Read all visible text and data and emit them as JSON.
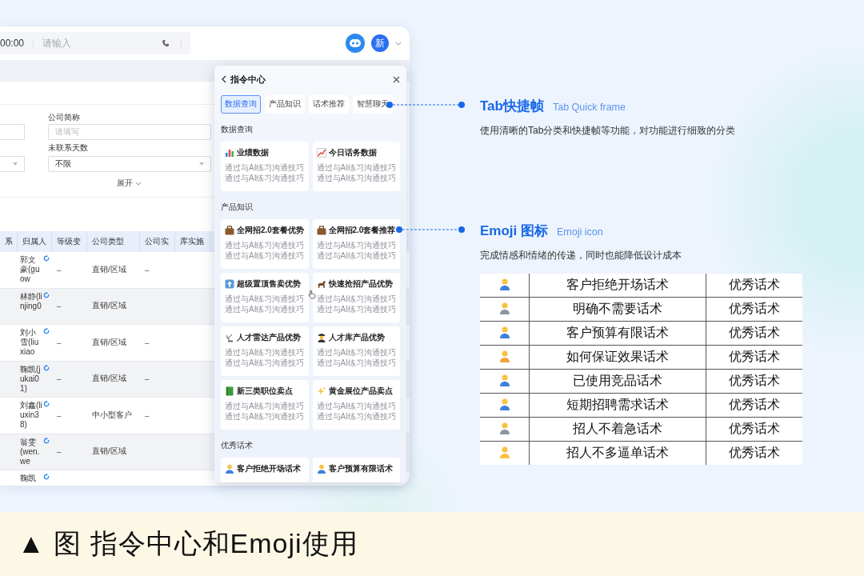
{
  "screen": {
    "top_bar": {
      "time": "00:00",
      "search_placeholder": "请输入",
      "new_badge": "新"
    },
    "form": {
      "fields": [
        {
          "label": "公司简称",
          "placeholder": "请填写"
        },
        {
          "label": "未联系天数",
          "value": "不限"
        }
      ],
      "expand": "展开"
    },
    "table": {
      "columns": [
        "系",
        "归属人",
        "等级变",
        "公司类型",
        "公司实",
        "库实施"
      ],
      "rows": [
        {
          "owner": "郭文豪(guow",
          "level": "–",
          "type": "直销/区域",
          "column_5": "–"
        },
        {
          "owner": "林静(linjing0",
          "level": "–",
          "type": "直销/区域"
        },
        {
          "owner": "刘小雪(liuxiao",
          "level": "–",
          "type": "直销/区域",
          "column_5": "–"
        },
        {
          "owner": "鞠凯(jukai01)",
          "level": "–",
          "type": "直销/区域",
          "column_5": "–"
        },
        {
          "owner": "刘鑫(liuxin38)",
          "level": "–",
          "type": "中小型客户",
          "column_5": "–"
        },
        {
          "owner": "翁雯(wen.we",
          "level": "–",
          "type": "直销/区域"
        },
        {
          "owner": "鞠凯"
        }
      ]
    }
  },
  "popup": {
    "title": "指令中心",
    "tabs": [
      {
        "label": "数据查询",
        "selected": true
      },
      {
        "label": "产品知识",
        "selected": false
      },
      {
        "label": "话术推荐",
        "selected": false
      },
      {
        "label": "智慧聊天",
        "selected": false
      }
    ],
    "sections": [
      {
        "title": "数据查询",
        "cards": [
          {
            "title": "业绩数据",
            "desc": "通过与AI练习沟通技巧通过与AI练习沟通技巧"
          },
          {
            "title": "今日话务数据",
            "desc": "通过与AI练习沟通技巧通过与AI练习沟通技巧"
          }
        ]
      },
      {
        "title": "产品知识",
        "cards": [
          {
            "title": "全网招2.0套餐优势",
            "desc": "通过与AI练习沟通技巧通过与AI练习沟通技巧"
          },
          {
            "title": "全网招2.0套餐推荐",
            "desc": "通过与AI练习沟通技巧通过与AI练习沟通技巧"
          },
          {
            "title": "超级置顶售卖优势",
            "desc": "通过与AI练习沟通技巧通过与AI练习沟通技巧"
          },
          {
            "title": "快速抢招产品优势",
            "desc": "通过与AI练习沟通技巧通过与AI练习沟通技巧"
          },
          {
            "title": "人才雷达产品优势",
            "desc": "通过与AI练习沟通技巧通过与AI练习沟通技巧"
          },
          {
            "title": "人才库产品优势",
            "desc": "通过与AI练习沟通技巧通过与AI练习沟通技巧"
          },
          {
            "title": "新三类职位卖点",
            "desc": "通过与AI练习沟通技巧通过与AI练习沟通技巧"
          },
          {
            "title": "黄金展位产品卖点",
            "desc": "通过与AI练习沟通技巧通过与AI练习沟通技巧"
          }
        ]
      },
      {
        "title": "优秀话术",
        "cards": [
          {
            "title": "客户拒绝开场话术"
          },
          {
            "title": "客户预算有限话术"
          }
        ]
      }
    ]
  },
  "annotations": [
    {
      "title": "Tab快捷帧",
      "subtitle": "Tab Quick frame",
      "text": "使用清晰的Tab分类和快捷帧等功能，对功能进行细致的分类"
    },
    {
      "title": "Emoji 图标",
      "subtitle": "Emoji icon",
      "text": "完成情感和情绪的传递，同时也能降低设计成本"
    }
  ],
  "phrase_table": {
    "rows": [
      {
        "name": "客户拒绝开场话术",
        "category": "优秀话术"
      },
      {
        "name": "明确不需要话术",
        "category": "优秀话术"
      },
      {
        "name": "客户预算有限话术",
        "category": "优秀话术"
      },
      {
        "name": "如何保证效果话术",
        "category": "优秀话术"
      },
      {
        "name": "已使用竞品话术",
        "category": "优秀话术"
      },
      {
        "name": "短期招聘需求话术",
        "category": "优秀话术"
      },
      {
        "name": "招人不着急话术",
        "category": "优秀话术"
      },
      {
        "name": "招人不多逼单话术",
        "category": "优秀话术"
      }
    ]
  },
  "caption": "▲ 图 指令中心和Emoji使用"
}
